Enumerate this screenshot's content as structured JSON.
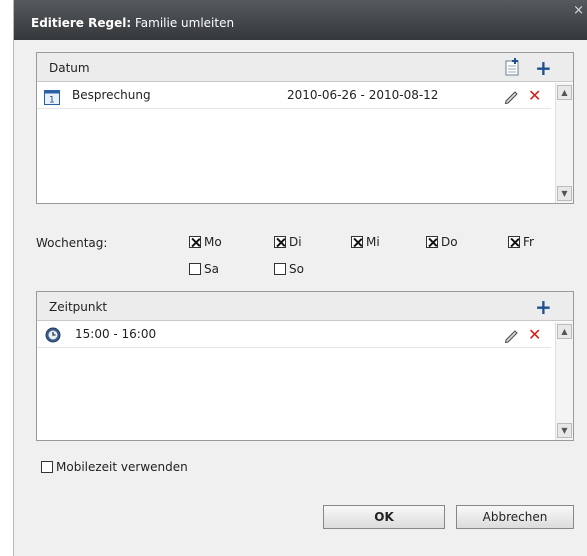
{
  "dialog": {
    "title_bold": "Editiere Regel:",
    "title_rest": "Familie umleiten",
    "close_glyph": "×"
  },
  "datum": {
    "header": "Datum",
    "items": [
      {
        "name": "Besprechung",
        "range": "2010-06-26 - 2010-08-12",
        "icon": "calendar-icon"
      }
    ]
  },
  "weekday": {
    "label": "Wochentag:",
    "days": [
      {
        "label": "Mo",
        "checked": true
      },
      {
        "label": "Di",
        "checked": true
      },
      {
        "label": "Mi",
        "checked": true
      },
      {
        "label": "Do",
        "checked": true
      },
      {
        "label": "Fr",
        "checked": true
      },
      {
        "label": "Sa",
        "checked": false
      },
      {
        "label": "So",
        "checked": false
      }
    ]
  },
  "zeitpunkt": {
    "header": "Zeitpunkt",
    "items": [
      {
        "time": "15:00 - 16:00",
        "icon": "clock-icon"
      }
    ]
  },
  "mobile": {
    "label": "Mobilezeit verwenden",
    "checked": false
  },
  "buttons": {
    "ok": "OK",
    "cancel": "Abbrechen"
  },
  "icons": {
    "plus": "+",
    "delete": "✕"
  },
  "colors": {
    "accent_blue": "#1f4f8f",
    "delete_red": "#e01818",
    "titlebar": "#3c4043"
  }
}
